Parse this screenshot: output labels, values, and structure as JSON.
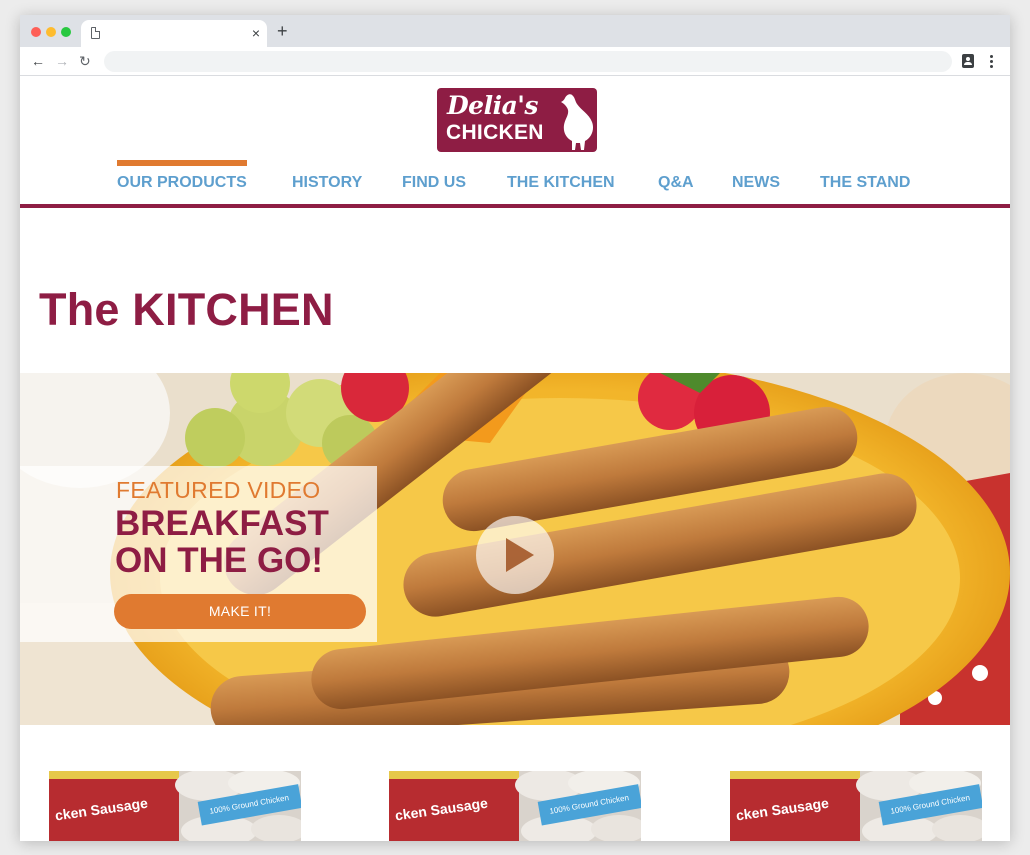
{
  "browser": {
    "tab_close": "×",
    "new_tab": "+",
    "back": "←",
    "forward": "→",
    "reload": "↻"
  },
  "logo": {
    "script": "Delia's",
    "word": "CHICKEN"
  },
  "nav": {
    "items": [
      "OUR PRODUCTS",
      "HISTORY",
      "FIND US",
      "THE KITCHEN",
      "Q&A",
      "NEWS",
      "THE STAND"
    ],
    "active": "OUR PRODUCTS"
  },
  "page": {
    "title": "The KITCHEN"
  },
  "feature": {
    "kicker": "FEATURED VIDEO",
    "title_line1": "BREAKFAST",
    "title_line2": "ON THE GO!",
    "button": "MAKE IT!"
  },
  "thumbnails": [
    {
      "label_left": "cken Sausage",
      "label_right": "100% Ground Chicken"
    },
    {
      "label_left": "cken Sausage",
      "label_right": "100% Ground Chicken"
    },
    {
      "label_left": "cken Sausage",
      "label_right": "100% Ground Chicken"
    }
  ],
  "colors": {
    "brand": "#8e1d44",
    "nav_link": "#5e9fce",
    "accent": "#e07a30"
  }
}
